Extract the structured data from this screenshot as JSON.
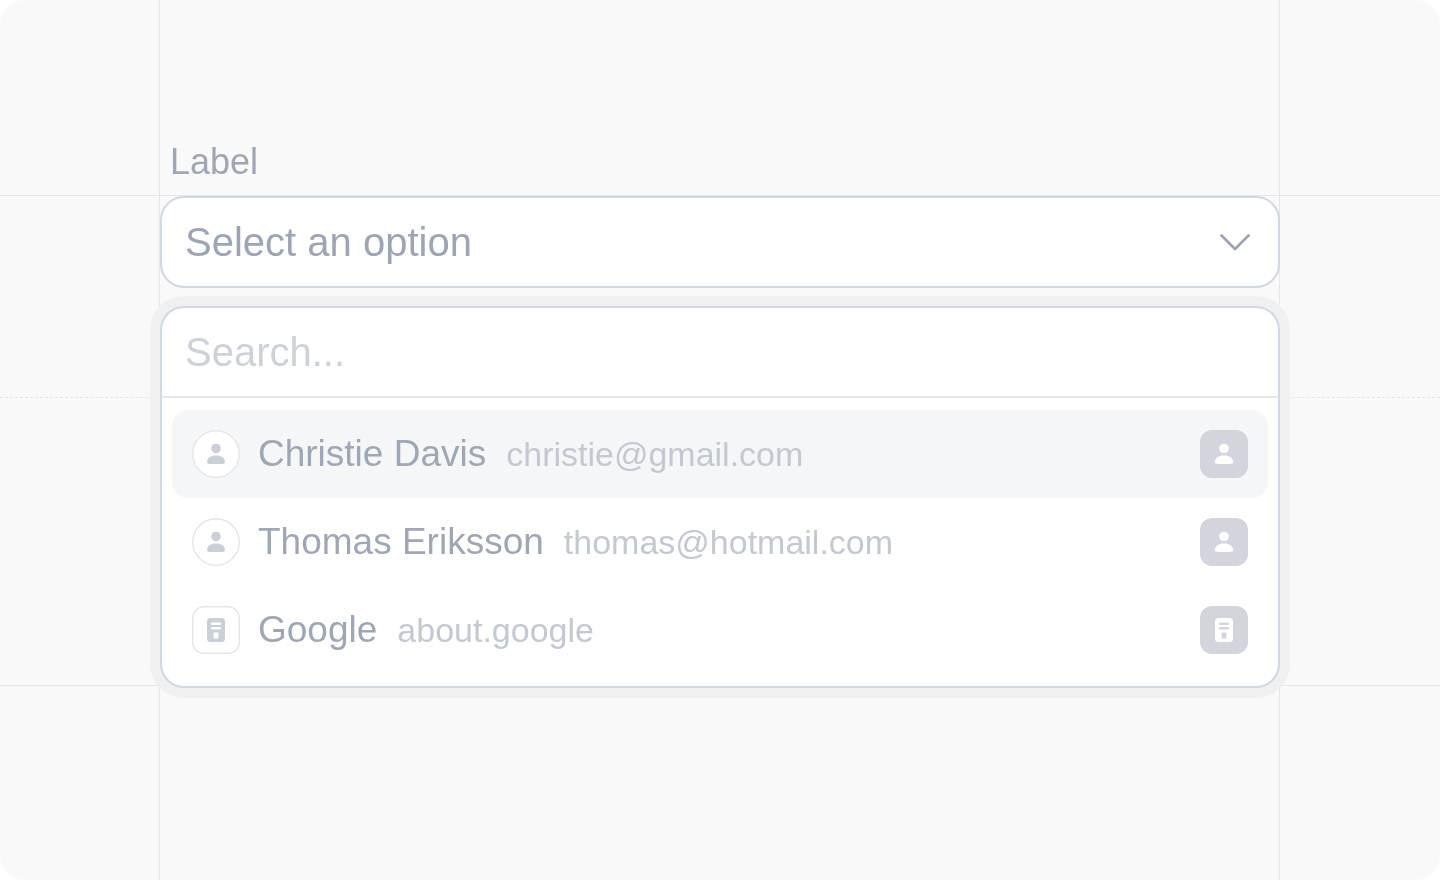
{
  "field": {
    "label": "Label",
    "placeholder": "Select an option",
    "expanded": true
  },
  "dropdown": {
    "search": {
      "placeholder": "Search..."
    },
    "options": [
      {
        "kind": "person",
        "name": "Christie Davis",
        "detail": "christie@gmail.com",
        "highlighted": true
      },
      {
        "kind": "person",
        "name": "Thomas Eriksson",
        "detail": "thomas@hotmail.com",
        "highlighted": false
      },
      {
        "kind": "company",
        "name": "Google",
        "detail": "about.google",
        "highlighted": false
      }
    ]
  }
}
